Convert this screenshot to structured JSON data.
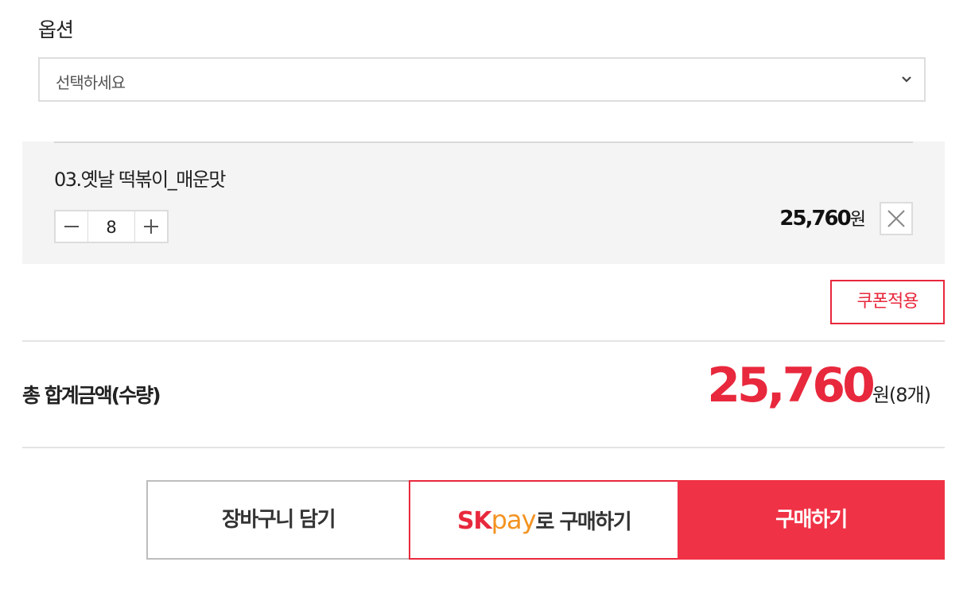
{
  "option": {
    "label": "옵션",
    "select_placeholder": "선택하세요"
  },
  "item": {
    "name": "03.옛날 떡볶이_매운맛",
    "quantity": "8",
    "price": "25,760",
    "price_unit": "원"
  },
  "coupon": {
    "label": "쿠폰적용"
  },
  "total": {
    "label": "총 합계금액(수량)",
    "amount": "25,760",
    "unit": "원",
    "count": "(8개)"
  },
  "buttons": {
    "cart": "장바구니 담기",
    "skpay_s": "S",
    "skpay_k": "K",
    "skpay_pay": "pay",
    "skpay_suffix": "로 구매하기",
    "buy": "구매하기"
  },
  "colors": {
    "accent": "#e8283c",
    "buy_bg": "#f03246",
    "skpay_orange": "#f39321"
  }
}
